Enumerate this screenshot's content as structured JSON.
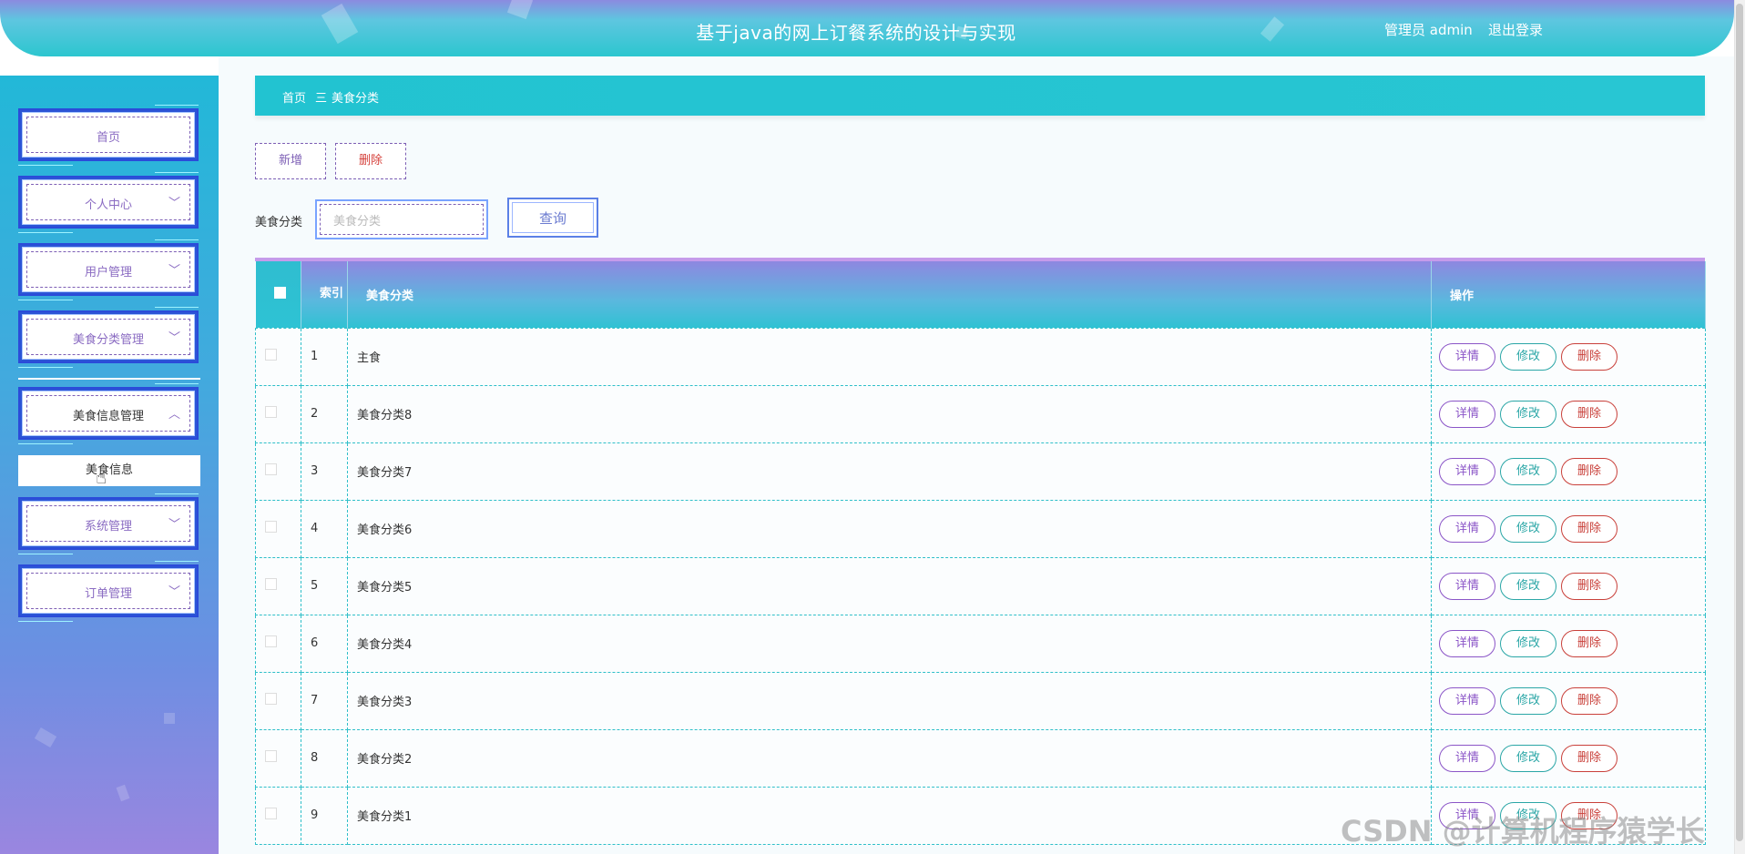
{
  "header": {
    "title": "基于java的网上订餐系统的设计与实现",
    "user": "管理员 admin",
    "logout": "退出登录"
  },
  "sidebar": {
    "items": [
      {
        "label": "首页",
        "has_chevron": false
      },
      {
        "label": "个人中心",
        "has_chevron": true,
        "chevron": "﹀"
      },
      {
        "label": "用户管理",
        "has_chevron": true,
        "chevron": "﹀"
      },
      {
        "label": "美食分类管理",
        "has_chevron": true,
        "chevron": "﹀"
      },
      {
        "label": "美食信息管理",
        "has_chevron": true,
        "chevron": "︿"
      },
      {
        "label": "系统管理",
        "has_chevron": true,
        "chevron": "﹀"
      },
      {
        "label": "订单管理",
        "has_chevron": true,
        "chevron": "﹀"
      }
    ],
    "submenu": {
      "label": "美食信息"
    }
  },
  "breadcrumb": {
    "home": "首页",
    "separator": "三",
    "current": "美食分类"
  },
  "toolbar": {
    "add_label": "新增",
    "delete_label": "删除"
  },
  "search": {
    "label": "美食分类",
    "placeholder": "美食分类",
    "button": "查询"
  },
  "table": {
    "headers": {
      "index": "索引",
      "category": "美食分类",
      "action": "操作"
    },
    "action_labels": {
      "detail": "详情",
      "edit": "修改",
      "delete": "删除"
    },
    "rows": [
      {
        "index": "1",
        "category": "主食"
      },
      {
        "index": "2",
        "category": "美食分类8"
      },
      {
        "index": "3",
        "category": "美食分类7"
      },
      {
        "index": "4",
        "category": "美食分类6"
      },
      {
        "index": "5",
        "category": "美食分类5"
      },
      {
        "index": "6",
        "category": "美食分类4"
      },
      {
        "index": "7",
        "category": "美食分类3"
      },
      {
        "index": "8",
        "category": "美食分类2"
      },
      {
        "index": "9",
        "category": "美食分类1"
      }
    ]
  },
  "watermark": "CSDN @计算机程序猿学长",
  "colors": {
    "primary_cyan": "#22c3d1",
    "purple": "#8b55c7",
    "teal": "#2aa6a6",
    "red": "#c9403a"
  }
}
